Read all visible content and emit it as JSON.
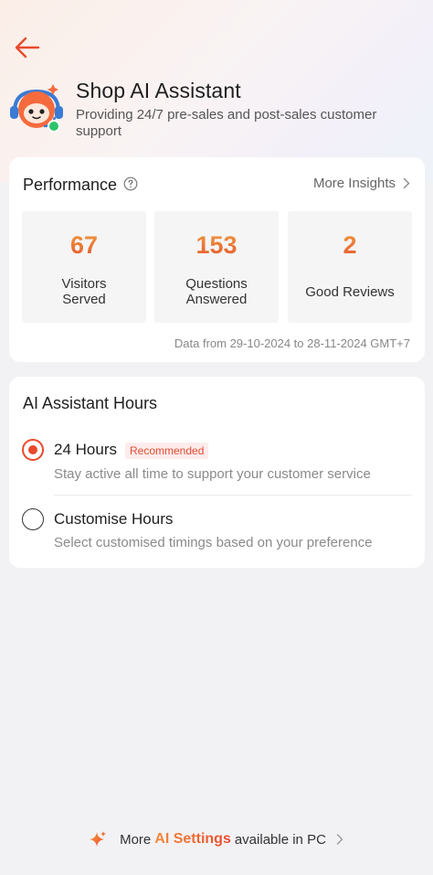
{
  "header": {
    "title": "Shop AI Assistant",
    "subtitle": "Providing 24/7 pre-sales and post-sales customer support"
  },
  "performance": {
    "title": "Performance",
    "more_insights": "More Insights",
    "stats": [
      {
        "value": "67",
        "label": "Visitors Served"
      },
      {
        "value": "153",
        "label": "Questions Answered"
      },
      {
        "value": "2",
        "label": "Good Reviews"
      }
    ],
    "date_range": "Data from 29-10-2024 to 28-11-2024 GMT+7"
  },
  "hours": {
    "title": "AI Assistant Hours",
    "options": [
      {
        "label": "24 Hours",
        "badge": "Recommended",
        "description": "Stay active all time to support your customer service",
        "selected": true
      },
      {
        "label": "Customise Hours",
        "description": "Select customised timings based on your preference",
        "selected": false
      }
    ]
  },
  "footer": {
    "prefix": "More",
    "highlight": "AI Settings",
    "suffix": "available in PC"
  },
  "colors": {
    "accent": "#e9492c",
    "stat_value": "#ec7a3c",
    "page_background": "#f2f2f4"
  },
  "icons": {
    "back": "arrow-left-icon",
    "help": "question-circle-icon",
    "chevron": "chevron-right-icon",
    "sparkle": "sparkle-icon",
    "mascot": "ai-mascot-icon"
  }
}
